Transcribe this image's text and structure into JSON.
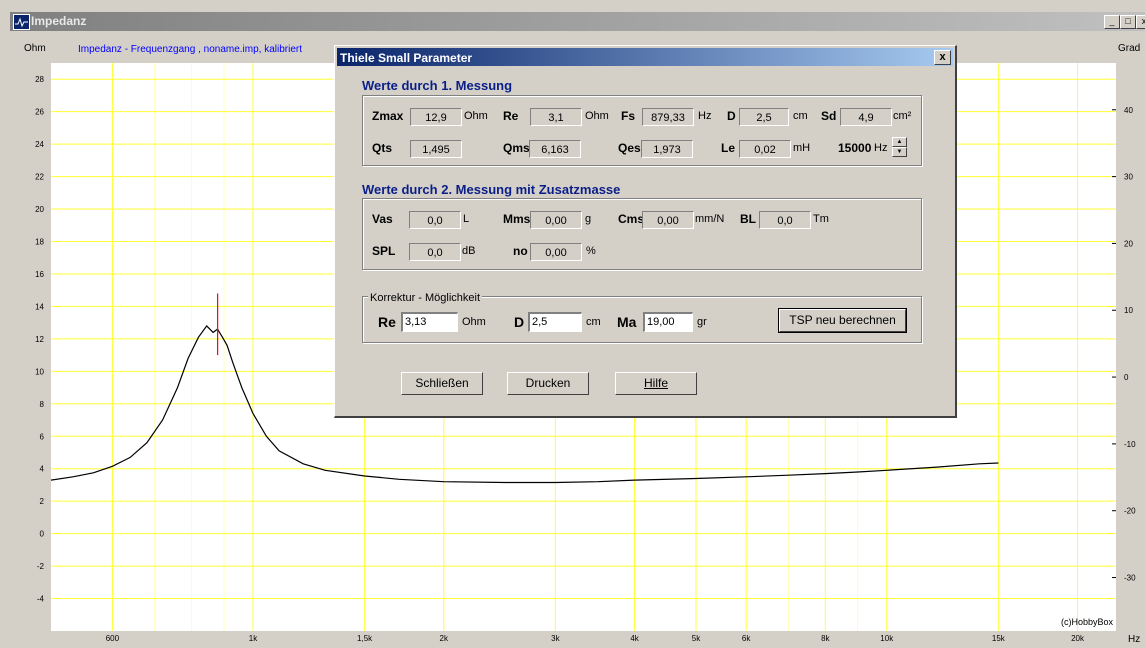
{
  "window": {
    "title": "Impedanz",
    "buttons": [
      "_",
      "□",
      "x"
    ]
  },
  "chart_data": {
    "type": "line",
    "title": "Impedanz - Frequenzgang , noname.imp, kalibriert",
    "ylabel_left": "Ohm",
    "ylabel_right": "Grad",
    "xunit": "Hz",
    "watermark": "(c)HobbyBox",
    "x_scale": "log",
    "xlim": [
      480,
      23000
    ],
    "ylim": [
      -6,
      29
    ],
    "ylim_right": [
      -38,
      47
    ],
    "grid": true,
    "grid_color": "#ffff33",
    "background": "#ffffff",
    "x_ticks": [
      600,
      1000,
      1500,
      2000,
      3000,
      4000,
      5000,
      6000,
      8000,
      10000,
      15000,
      20000
    ],
    "x_tick_labels": [
      "600",
      "1k",
      "1,5k",
      "2k",
      "3k",
      "4k",
      "5k",
      "6k",
      "8k",
      "10k",
      "15k",
      "20k"
    ],
    "y_ticks": [
      -4,
      -2,
      0,
      2,
      4,
      6,
      8,
      10,
      12,
      14,
      16,
      18,
      20,
      22,
      24,
      26,
      28
    ],
    "y_right_ticks": [
      -30,
      -20,
      -10,
      0,
      10,
      20,
      30,
      40
    ],
    "marker_freq": 879.33,
    "marker_range": [
      11,
      14.8
    ],
    "marker_color": "#ff0000",
    "series": [
      {
        "line_color": "#000000",
        "x": [
          480,
          520,
          560,
          600,
          640,
          680,
          720,
          760,
          790,
          820,
          845,
          865,
          879,
          895,
          910,
          930,
          960,
          1000,
          1050,
          1100,
          1200,
          1300,
          1500,
          1700,
          2000,
          2500,
          3000,
          3500,
          4000,
          5000,
          6000,
          7000,
          8000,
          9000,
          10000,
          12000,
          14000,
          15000
        ],
        "y": [
          3.3,
          3.5,
          3.75,
          4.15,
          4.7,
          5.6,
          7.0,
          9.0,
          10.8,
          12.1,
          12.8,
          12.4,
          12.6,
          12.1,
          11.6,
          10.5,
          9.0,
          7.4,
          6.0,
          5.1,
          4.3,
          3.9,
          3.55,
          3.35,
          3.2,
          3.15,
          3.15,
          3.2,
          3.3,
          3.4,
          3.5,
          3.6,
          3.7,
          3.8,
          3.9,
          4.1,
          4.3,
          4.35
        ]
      }
    ]
  },
  "dialog": {
    "title": "Thiele Small Parameter",
    "close": "x",
    "section1": {
      "heading": "Werte durch 1. Messung",
      "zmax": {
        "label": "Zmax",
        "value": "12,9",
        "unit": "Ohm"
      },
      "re": {
        "label": "Re",
        "value": "3,1",
        "unit": "Ohm"
      },
      "fs": {
        "label": "Fs",
        "value": "879,33",
        "unit": "Hz"
      },
      "d": {
        "label": "D",
        "value": "2,5",
        "unit": "cm"
      },
      "sd": {
        "label": "Sd",
        "value": "4,9",
        "unit": "cm²"
      },
      "qts": {
        "label": "Qts",
        "value": "1,495"
      },
      "qms": {
        "label": "Qms",
        "value": "6,163"
      },
      "qes": {
        "label": "Qes",
        "value": "1,973"
      },
      "le": {
        "label": "Le",
        "value": "0,02",
        "unit": "mH"
      },
      "freq": {
        "value": "15000",
        "unit": "Hz"
      }
    },
    "section2": {
      "heading": "Werte durch 2. Messung mit Zusatzmasse",
      "vas": {
        "label": "Vas",
        "value": "0,0",
        "unit": "L"
      },
      "mms": {
        "label": "Mms",
        "value": "0,00",
        "unit": "g"
      },
      "cms": {
        "label": "Cms",
        "value": "0,00",
        "unit": "mm/N"
      },
      "bl": {
        "label": "BL",
        "value": "0,0",
        "unit": "Tm"
      },
      "spl": {
        "label": "SPL",
        "value": "0,0",
        "unit": "dB"
      },
      "no": {
        "label": "no",
        "value": "0,00",
        "unit": "%"
      }
    },
    "correction": {
      "legend": "Korrektur - Möglichkeit",
      "re": {
        "label": "Re",
        "value": "3,13",
        "unit": "Ohm"
      },
      "d": {
        "label": "D",
        "value": "2,5",
        "unit": "cm"
      },
      "ma": {
        "label": "Ma",
        "value": "19,00",
        "unit": "gr"
      },
      "recalc_button": "TSP neu berechnen"
    },
    "buttons": {
      "close": "Schließen",
      "print": "Drucken",
      "help": "Hilfe"
    }
  }
}
